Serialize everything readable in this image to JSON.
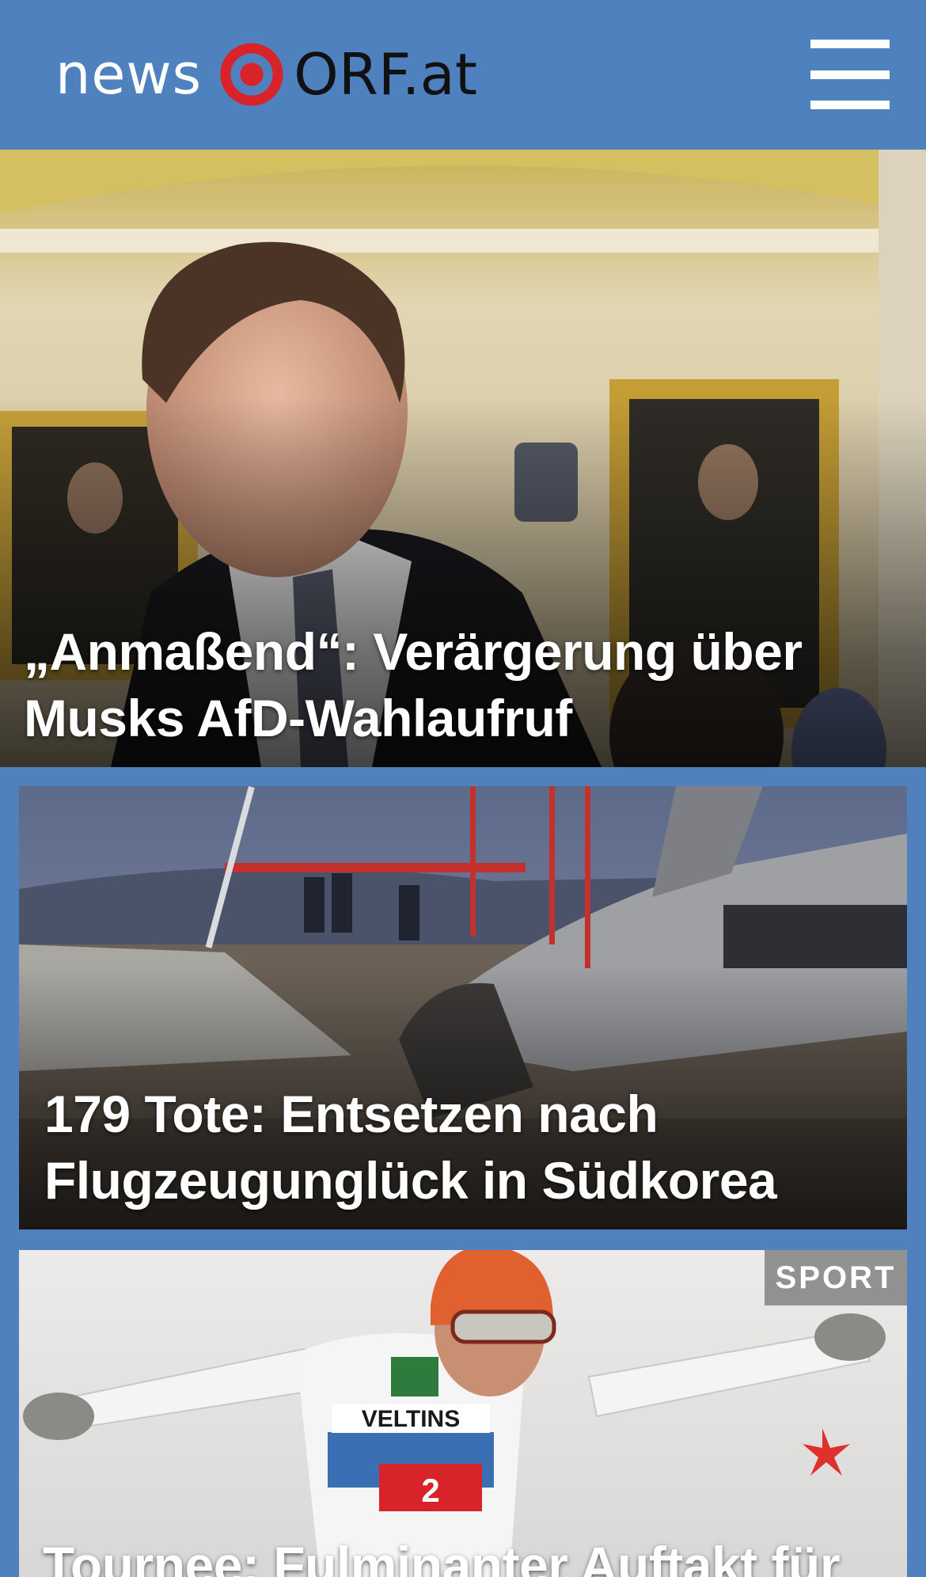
{
  "header": {
    "logo_news": "news",
    "logo_orf": "ORF.at",
    "brand_red": "#d8232a",
    "background": "#4f81bf",
    "menu_icon": "hamburger-menu-icon"
  },
  "stories": [
    {
      "headline": "„Anmaßend“: Verärgerung über Musks AfD-Wahlaufruf",
      "image": "man-in-suit-capitol-hallway"
    },
    {
      "headline": "179 Tote: Entsetzen nach Flugzeugunglück in Südkorea",
      "image": "plane-crash-wreckage-airport"
    },
    {
      "headline": "Tournee: Fulminanter Auftakt für",
      "badge": "SPORT",
      "image": "ski-jumper-landing"
    }
  ]
}
